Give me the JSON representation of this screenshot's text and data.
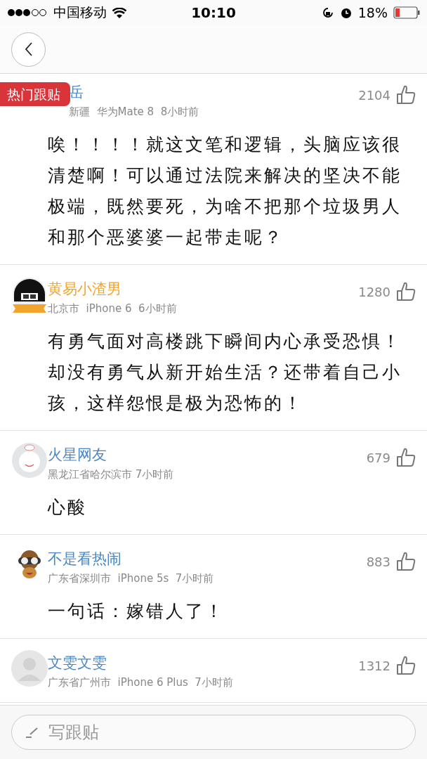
{
  "status_bar": {
    "carrier": "中国移动",
    "time": "10:10",
    "battery": "18%"
  },
  "hot_badge": "热门跟贴",
  "comments": [
    {
      "name": "岳",
      "vip": false,
      "meta": "新疆  华为Mate 8  8小时前",
      "likes": "2104",
      "text": "唉！！！！就这文笔和逻辑，头脑应该很清楚啊！可以通过法院来解决的坚决不能极端，既然要死，为啥不把那个垃圾男人和那个恶婆婆一起带走呢？"
    },
    {
      "name": "黄易小渣男",
      "vip": true,
      "meta": "北京市  iPhone 6  6小时前",
      "likes": "1280",
      "text": "有勇气面对高楼跳下瞬间内心承受恐惧！却没有勇气从新开始生活？还带着自己小孩，这样怨恨是极为恐怖的！"
    },
    {
      "name": "火星网友",
      "vip": false,
      "meta": "黑龙江省哈尔滨市 7小时前",
      "likes": "679",
      "text": "心酸"
    },
    {
      "name": "不是看热闹",
      "vip": false,
      "meta": "广东省深圳市  iPhone 5s  7小时前",
      "likes": "883",
      "text": "一句话：嫁错人了！"
    },
    {
      "name": "文雯文雯",
      "vip": false,
      "meta": "广东省广州市  iPhone 6 Plus  7小时前",
      "likes": "1312"
    }
  ],
  "reply_field": {
    "placeholder": "写跟贴"
  }
}
